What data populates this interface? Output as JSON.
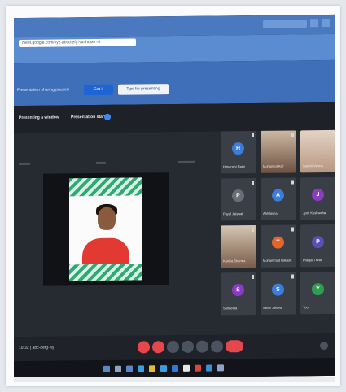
{
  "browser": {
    "url": "meet.google.com/xyz-abcd-efg?authuser=0"
  },
  "banner": {
    "link_text": "",
    "text": "Presentation sharing paused",
    "primary_button": "Got it",
    "secondary_button": "Tips for presenting"
  },
  "infobar": {
    "presenting_label": "Presenting a window",
    "presenter_label": "Presentation starts"
  },
  "tiles": [
    {
      "name": "Himanshi Rathi",
      "avatar": "H",
      "color": "#3b7dd8"
    },
    {
      "name": "Mohamed Asif",
      "avatar": "",
      "color": ""
    },
    {
      "name": "Sakshi Verma",
      "avatar": "",
      "color": ""
    },
    {
      "name": "Payal Jaiswal",
      "avatar": "P",
      "color": "#6b6e75"
    },
    {
      "name": "Abhilasha",
      "avatar": "A",
      "color": "#3b7dd8"
    },
    {
      "name": "Jyoti Kushwaha",
      "avatar": "J",
      "color": "#8a3cc2"
    },
    {
      "name": "Kanika Sharma",
      "avatar": "",
      "color": ""
    },
    {
      "name": "Mohammad Dilkash",
      "avatar": "T",
      "color": "#e5662a"
    },
    {
      "name": "Pranjal Tiwari",
      "avatar": "P",
      "color": "#5a4fb6"
    },
    {
      "name": "Sangeeta",
      "avatar": "S",
      "color": "#8a3cc2"
    },
    {
      "name": "Swati Jaiswal",
      "avatar": "S",
      "color": "#3b7dd8"
    },
    {
      "name": "You",
      "avatar": "Y",
      "color": "#2f9e4f"
    }
  ],
  "controls": {
    "left_label": "10:32 | abc-defg-hij"
  }
}
